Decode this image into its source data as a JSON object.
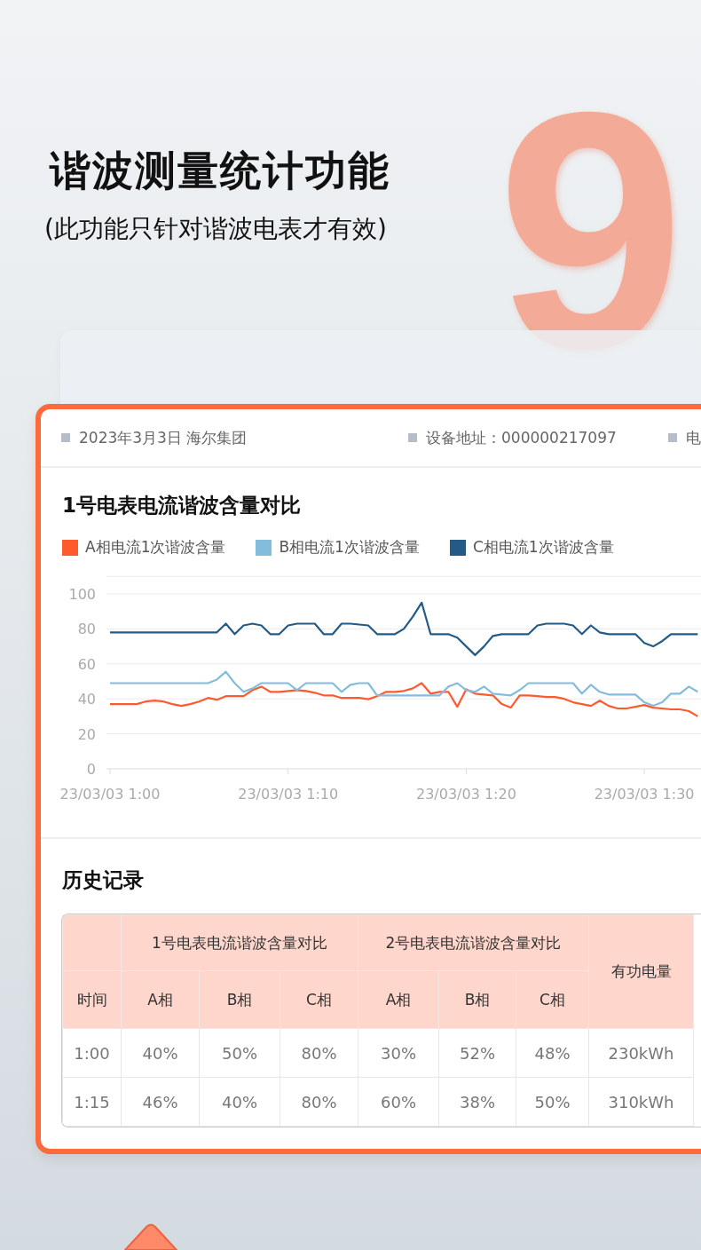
{
  "hero": {
    "title": "谐波测量统计功能",
    "subtitle": "(此功能只针对谐波电表才有效)",
    "number": "9"
  },
  "card": {
    "info": [
      {
        "text": "2023年3月3日 海尔集团"
      },
      {
        "text": "设备地址：000000217097"
      },
      {
        "text": "电"
      }
    ],
    "chart_section": {
      "title": "1号电表电流谐波含量对比",
      "chart_data": {
        "type": "line",
        "categories": [
          "23/03/03 1:00",
          null,
          null,
          null,
          null,
          null,
          null,
          null,
          null,
          null,
          null,
          null,
          null,
          null,
          null,
          null,
          null,
          null,
          null,
          null,
          "23/03/03 1:10",
          null,
          null,
          null,
          null,
          null,
          null,
          null,
          null,
          null,
          null,
          null,
          null,
          null,
          null,
          null,
          null,
          null,
          null,
          null,
          "23/03/03 1:20",
          null,
          null,
          null,
          null,
          null,
          null,
          null,
          null,
          null,
          null,
          null,
          null,
          null,
          null,
          null,
          null,
          null,
          null,
          null,
          "23/03/03 1:30",
          null,
          null,
          null,
          null,
          null,
          null
        ],
        "ylim": [
          0,
          110
        ],
        "grid": true,
        "yticks": [
          0,
          20,
          40,
          60,
          80,
          100
        ],
        "series": [
          {
            "name": "A相电流1次谐波含量",
            "color": "#ff5a2e",
            "values": [
              37,
              37,
              37,
              37,
              38.5,
              39,
              38.5,
              37,
              36,
              37,
              38.5,
              40.5,
              39.5,
              41.5,
              41.5,
              41.5,
              45,
              47,
              44,
              44,
              44.5,
              45,
              44.5,
              43.5,
              42,
              42,
              40.5,
              40.5,
              40.5,
              39.8,
              41.5,
              44,
              44,
              44.5,
              46,
              49,
              43,
              44,
              44,
              35.5,
              45.5,
              43,
              42.5,
              42,
              37,
              35,
              42,
              42,
              41.5,
              41,
              41,
              40,
              38,
              37,
              36,
              39,
              36,
              34.5,
              34.5,
              35.5,
              36.5,
              35,
              34.5,
              34,
              34,
              33,
              30
            ]
          },
          {
            "name": "B相电流1次谐波含量",
            "color": "#84bcdb",
            "values": [
              49,
              49,
              49,
              49,
              49,
              49,
              49,
              49,
              49,
              49,
              49,
              49,
              51,
              55.5,
              49,
              44,
              46,
              49,
              49,
              49,
              49,
              45,
              49,
              49,
              49,
              49,
              44,
              48,
              49,
              49,
              42,
              42,
              42,
              42,
              42,
              42,
              42,
              42,
              47,
              49,
              45,
              44,
              47,
              43,
              42.5,
              42,
              45,
              49,
              49,
              49,
              49,
              49,
              49,
              43,
              48,
              44,
              42.5,
              42.5,
              42.5,
              42.5,
              38,
              36,
              38,
              43,
              43,
              47,
              44
            ]
          },
          {
            "name": "C相电流1次谐波含量",
            "color": "#235a86",
            "values": [
              78,
              78,
              78,
              78,
              78,
              78,
              78,
              78,
              78,
              78,
              78,
              78,
              78,
              83,
              77,
              82,
              83,
              82,
              77,
              77,
              82,
              83,
              83,
              83,
              77,
              77,
              83,
              83,
              82.5,
              82,
              77,
              77,
              77,
              80,
              87,
              95,
              77,
              77,
              77,
              75,
              70,
              65,
              70,
              76,
              77,
              77,
              77,
              77,
              82,
              83,
              83,
              83,
              82,
              77,
              82,
              78,
              77,
              77,
              77,
              77,
              72,
              70,
              73,
              77,
              77,
              77,
              77
            ]
          }
        ]
      }
    },
    "history": {
      "title": "历史记录",
      "group_headers": [
        "1号电表电流谐波含量对比",
        "2号电表电流谐波含量对比"
      ],
      "time_header": "时间",
      "energy_header": "有功电量",
      "phase_headers": [
        "A相",
        "B相",
        "C相",
        "A相",
        "B相",
        "C相"
      ],
      "rows": [
        [
          "1:00",
          "40%",
          "50%",
          "80%",
          "30%",
          "52%",
          "48%",
          "230kWh"
        ],
        [
          "1:15",
          "46%",
          "40%",
          "80%",
          "60%",
          "38%",
          "50%",
          "310kWh"
        ]
      ]
    }
  }
}
